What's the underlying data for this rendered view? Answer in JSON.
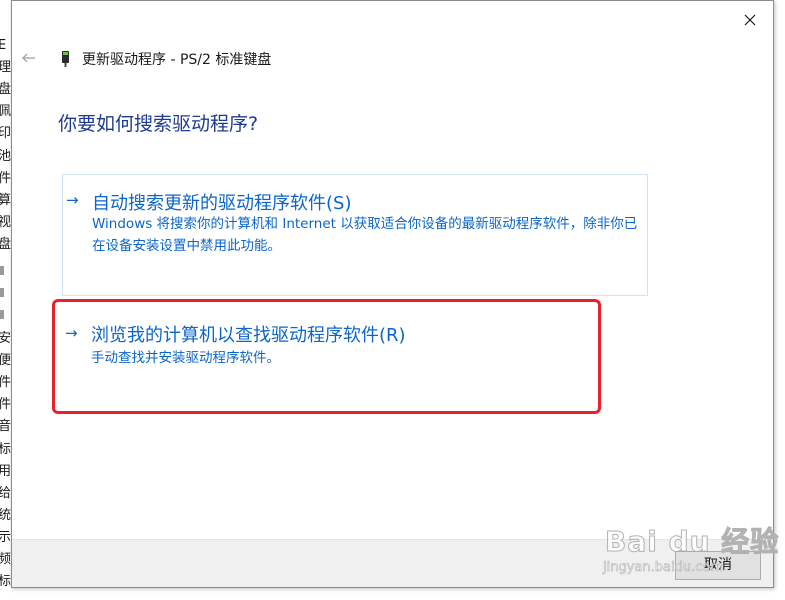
{
  "dialog": {
    "title": "更新驱动程序 - PS/2 标准键盘",
    "question": "你要如何搜索驱动程序?",
    "options": [
      {
        "title": "自动搜索更新的驱动程序软件(S)",
        "description": "Windows 将搜索你的计算机和 Internet 以获取适合你设备的最新驱动程序软件，除非你已在设备安装设置中禁用此功能。"
      },
      {
        "title": "浏览我的计算机以查找驱动程序软件(R)",
        "description": "手动查找并安装驱动程序软件。"
      }
    ],
    "arrow_glyph": "→",
    "cancel_label": "取消",
    "icons": {
      "back": "back-arrow-icon",
      "close": "close-icon",
      "device": "keyboard-device-icon"
    }
  },
  "background_window": {
    "visible_chars": [
      "E",
      "理",
      "盘",
      "佩",
      "印",
      "池",
      "件",
      "算",
      "视",
      "盘",
      "安",
      "便",
      "件",
      "件",
      "音",
      "标",
      "用",
      "给",
      "统",
      "示",
      "频",
      "标"
    ]
  },
  "annotation": {
    "highlight_color": "#e8212b"
  },
  "watermark": {
    "logo_text": "Bai du 经验",
    "url": "jingyan.baidu.com"
  },
  "colors": {
    "link_blue": "#0c66c8",
    "question_blue": "#1f3b8f"
  }
}
